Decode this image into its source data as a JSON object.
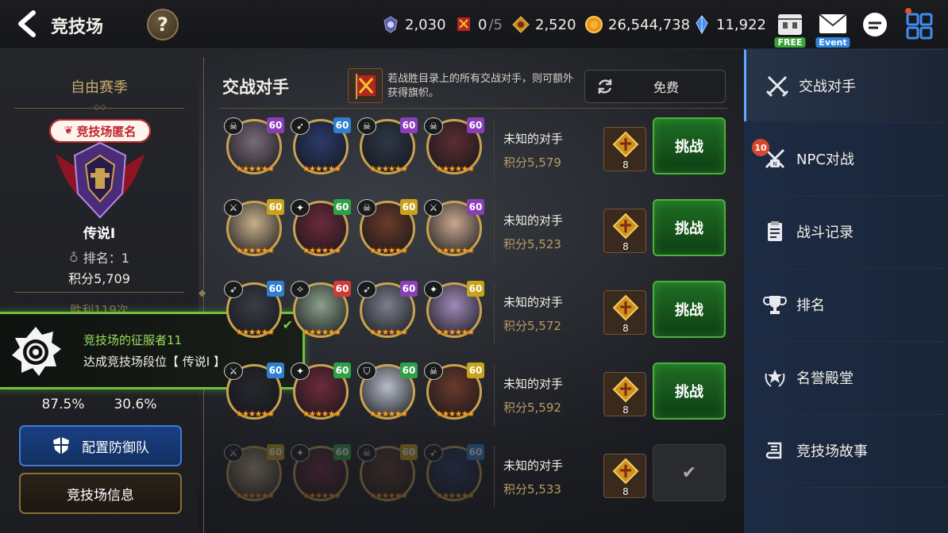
{
  "header": {
    "title": "竞技场",
    "help_label": "?",
    "currencies": [
      {
        "name": "arena-points",
        "icon": "skull-crest-icon",
        "value": "2,030"
      },
      {
        "name": "flags",
        "icon": "flag-icon",
        "value": "0",
        "max": "/5"
      },
      {
        "name": "medals",
        "icon": "medal-icon",
        "value": "2,520"
      },
      {
        "name": "gold",
        "icon": "gold-coin-icon",
        "value": "26,544,738"
      },
      {
        "name": "crystals",
        "icon": "crystal-icon",
        "value": "11,922"
      }
    ],
    "free_label": "FREE",
    "event_label": "Event"
  },
  "left": {
    "season": "自由赛季",
    "anonymous_badge": "竞技场匿名",
    "tier": "传说Ⅰ",
    "rank_label": "排名：1",
    "score": "积分5,709",
    "wins": "胜利119次",
    "rate_1": "87.5%",
    "rate_2": "30.6%",
    "defense_button": "配置防御队",
    "info_button": "竞技场信息"
  },
  "toast": {
    "title": "竞技场的征服者11",
    "description": "达成竞技场段位【 传说Ⅰ 】",
    "check": "✔"
  },
  "main": {
    "title": "交战对手",
    "flag_hint": "若战胜目录上的所有交战对手，则可额外获得旗帜。",
    "refresh_label": "免费",
    "challenge_label": "挑战",
    "done_label": "✔",
    "opponents": [
      {
        "name": "未知的对手",
        "score": "积分5,579",
        "medal_count": "8",
        "done": false,
        "heroes": [
          {
            "level": "60",
            "level_color": "#8a3fb8",
            "cls": "☠",
            "hue": "#7a6b79"
          },
          {
            "level": "60",
            "level_color": "#2e7fd1",
            "cls": "➶",
            "hue": "#2c3a6b"
          },
          {
            "level": "60",
            "level_color": "#8a3fb8",
            "cls": "☠",
            "hue": "#2d3847"
          },
          {
            "level": "60",
            "level_color": "#8a3fb8",
            "cls": "☠",
            "hue": "#5b2e30"
          }
        ]
      },
      {
        "name": "未知的对手",
        "score": "积分5,523",
        "medal_count": "8",
        "done": false,
        "heroes": [
          {
            "level": "60",
            "level_color": "#c9a21b",
            "cls": "⚔",
            "hue": "#c7b08a"
          },
          {
            "level": "60",
            "level_color": "#2fa04a",
            "cls": "✦",
            "hue": "#6e2a3b"
          },
          {
            "level": "60",
            "level_color": "#c9a21b",
            "cls": "☠",
            "hue": "#6a3a2a"
          },
          {
            "level": "60",
            "level_color": "#8a3fb8",
            "cls": "⚔",
            "hue": "#c9a890"
          }
        ]
      },
      {
        "name": "未知的对手",
        "score": "积分5,572",
        "medal_count": "8",
        "done": false,
        "heroes": [
          {
            "level": "60",
            "level_color": "#2e7fd1",
            "cls": "➶",
            "hue": "#3a3d47"
          },
          {
            "level": "60",
            "level_color": "#d13a3a",
            "cls": "✧",
            "hue": "#8aa08a"
          },
          {
            "level": "60",
            "level_color": "#8a3fb8",
            "cls": "➶",
            "hue": "#7b7f8c"
          },
          {
            "level": "60",
            "level_color": "#c9a21b",
            "cls": "✦",
            "hue": "#a08ab8"
          }
        ]
      },
      {
        "name": "未知的对手",
        "score": "积分5,592",
        "medal_count": "8",
        "done": false,
        "heroes": [
          {
            "level": "60",
            "level_color": "#2e7fd1",
            "cls": "⚔",
            "hue": "#26282e"
          },
          {
            "level": "60",
            "level_color": "#2fa04a",
            "cls": "✦",
            "hue": "#6e2a3b"
          },
          {
            "level": "60",
            "level_color": "#2fa04a",
            "cls": "⛉",
            "hue": "#b7bdc8"
          },
          {
            "level": "60",
            "level_color": "#c9a21b",
            "cls": "☠",
            "hue": "#6a3a2a"
          }
        ]
      },
      {
        "name": "未知的对手",
        "score": "积分5,533",
        "medal_count": "8",
        "done": true,
        "heroes": [
          {
            "level": "60",
            "level_color": "#c9a21b",
            "cls": "⚔",
            "hue": "#c7b08a"
          },
          {
            "level": "60",
            "level_color": "#2fa04a",
            "cls": "✦",
            "hue": "#6e2a3b"
          },
          {
            "level": "60",
            "level_color": "#c9a21b",
            "cls": "☠",
            "hue": "#6a3a2a"
          },
          {
            "level": "60",
            "level_color": "#2e7fd1",
            "cls": "➶",
            "hue": "#2c3a6b"
          }
        ]
      }
    ]
  },
  "menu": {
    "items": [
      {
        "label": "交战对手",
        "icon": "crossed-swords-icon",
        "active": true
      },
      {
        "label": "NPC对战",
        "icon": "npc-battle-icon",
        "badge": "10"
      },
      {
        "label": "战斗记录",
        "icon": "clipboard-icon"
      },
      {
        "label": "排名",
        "icon": "trophy-icon"
      },
      {
        "label": "名誉殿堂",
        "icon": "laurel-star-icon"
      },
      {
        "label": "竞技场故事",
        "icon": "scroll-icon"
      }
    ]
  },
  "colors": {
    "accent_gold": "#c7a86a",
    "challenge_green": "#48b33a",
    "defense_blue": "#3f79d6",
    "menu_active": "#5fa8ff"
  }
}
